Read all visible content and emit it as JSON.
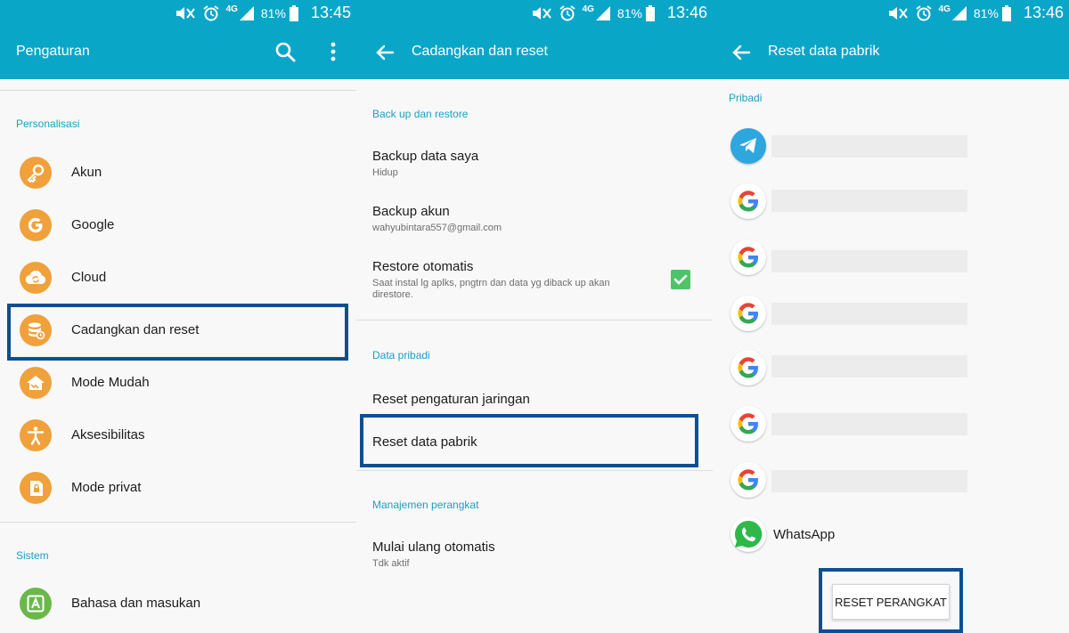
{
  "status_bar": {
    "lte": "4G",
    "battery": "81%",
    "time_1": "13:45",
    "time_2": "13:46",
    "time_3": "13:46"
  },
  "screen1": {
    "title": "Pengaturan",
    "sections": {
      "personal": "Personalisasi",
      "system": "Sistem"
    },
    "items": [
      {
        "label": "Akun",
        "icon": "key-icon"
      },
      {
        "label": "Google",
        "icon": "google-icon"
      },
      {
        "label": "Cloud",
        "icon": "cloud-icon"
      },
      {
        "label": "Cadangkan dan reset",
        "icon": "backup-icon"
      },
      {
        "label": "Mode Mudah",
        "icon": "home-icon"
      },
      {
        "label": "Aksesibilitas",
        "icon": "accessibility-icon"
      },
      {
        "label": "Mode privat",
        "icon": "private-icon"
      }
    ],
    "system_items": [
      {
        "label": "Bahasa dan masukan",
        "icon": "language-icon"
      }
    ]
  },
  "screen2": {
    "title": "Cadangkan dan reset",
    "sections": {
      "backup": "Back up dan restore",
      "personal": "Data pribadi",
      "device": "Manajemen perangkat"
    },
    "backup_items": [
      {
        "title": "Backup data saya",
        "subtitle": "Hidup"
      },
      {
        "title": "Backup akun",
        "subtitle": "wahyubintara557@gmail.com"
      },
      {
        "title": "Restore otomatis",
        "subtitle": "Saat instal lg aplks, pngtrn dan data yg diback up akan direstore."
      }
    ],
    "personal_items": [
      {
        "title": "Reset pengaturan jaringan"
      },
      {
        "title": "Reset data pabrik"
      }
    ],
    "device_items": [
      {
        "title": "Mulai ulang otomatis",
        "subtitle": "Tdk aktif"
      }
    ]
  },
  "screen3": {
    "title": "Reset data pabrik",
    "section": "Pribadi",
    "accounts": [
      {
        "icon": "telegram-icon"
      },
      {
        "icon": "google-icon"
      },
      {
        "icon": "google-icon"
      },
      {
        "icon": "google-icon"
      },
      {
        "icon": "google-icon"
      },
      {
        "icon": "google-icon"
      },
      {
        "icon": "google-icon"
      },
      {
        "icon": "whatsapp-icon",
        "label": "WhatsApp"
      }
    ],
    "reset_button": "RESET PERANGKAT"
  },
  "colors": {
    "toolbar": "#0aa6c8",
    "section_text": "#1aa0c2",
    "icon_bubble": "#f0a13b",
    "highlight": "#0d4f94",
    "check": "#4ec36a"
  }
}
